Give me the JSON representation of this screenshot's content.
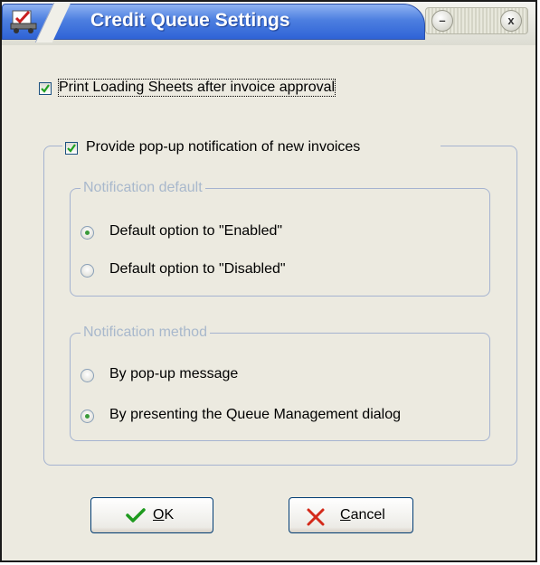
{
  "window": {
    "title": "Credit Queue Settings",
    "minimize_glyph": "–",
    "close_glyph": "x"
  },
  "print_loading": {
    "label": "Print Loading Sheets after invoice approval",
    "checked": true
  },
  "popup_notification": {
    "label": "Provide pop-up notification of new invoices",
    "checked": true
  },
  "notification_default": {
    "legend": "Notification default",
    "options": [
      {
        "label": "Default option to \"Enabled\"",
        "selected": true
      },
      {
        "label": "Default option to \"Disabled\"",
        "selected": false
      }
    ]
  },
  "notification_method": {
    "legend": "Notification method",
    "options": [
      {
        "label": "By pop-up message",
        "selected": false
      },
      {
        "label": "By presenting the Queue Management dialog",
        "selected": true
      }
    ]
  },
  "buttons": {
    "ok_label": "OK",
    "cancel_label": "Cancel"
  },
  "colors": {
    "title_bar_blue": "#3a6fdc",
    "ok_check_green": "#1e9a1e",
    "cancel_x_red": "#d42a1a",
    "group_border": "#a5b3d0",
    "disabled_legend": "#a8b8cc"
  }
}
